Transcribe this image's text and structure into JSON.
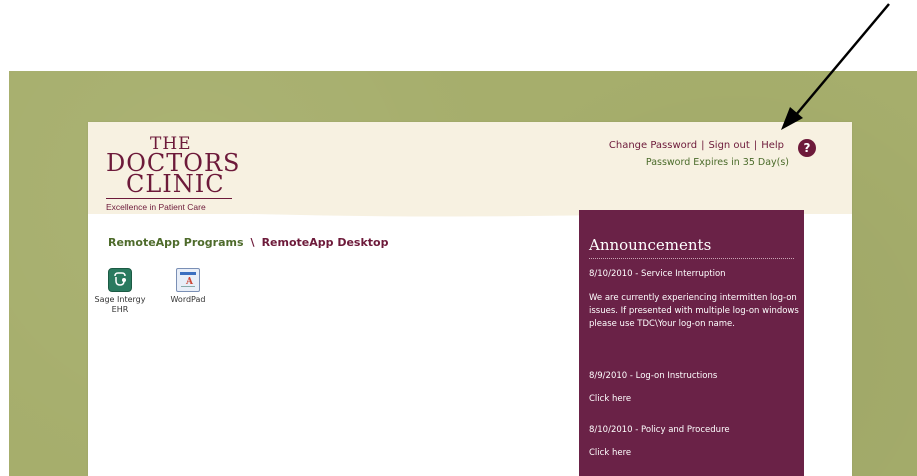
{
  "logo": {
    "line1": "THE",
    "line2": "DOCTORS",
    "line3": "CLINIC",
    "tagline": "Excellence in Patient Care"
  },
  "header": {
    "change_password": "Change Password",
    "sign_out": "Sign out",
    "help": "Help",
    "separator": "|",
    "help_icon_glyph": "?",
    "password_expires": "Password Expires in 35 Day(s)"
  },
  "tabs": {
    "programs": "RemoteApp Programs",
    "separator": "\\",
    "desktop": "RemoteApp Desktop"
  },
  "apps": [
    {
      "label_line1": "Sage Intergy",
      "label_line2": "EHR",
      "icon": "sage-intergy-icon"
    },
    {
      "label_line1": "WordPad",
      "label_line2": "",
      "icon": "wordpad-icon"
    }
  ],
  "announcements": {
    "title": "Announcements",
    "items": [
      {
        "heading": "8/10/2010 - Service Interruption",
        "body": "We are currently experiencing intermitten log-on issues.  If presented with multiple log-on windows please use TDC\\Your log-on name."
      },
      {
        "heading": "8/9/2010 - Log-on Instructions",
        "body": "Click here"
      },
      {
        "heading": "8/10/2010 - Policy and Procedure",
        "body": "Click here"
      }
    ]
  },
  "colors": {
    "brand_maroon": "#6d1a3a",
    "announce_bg": "#6a2247",
    "desk_green": "#a6ae6c",
    "header_cream": "#f7f1e1",
    "link_green": "#4e6b2b"
  }
}
